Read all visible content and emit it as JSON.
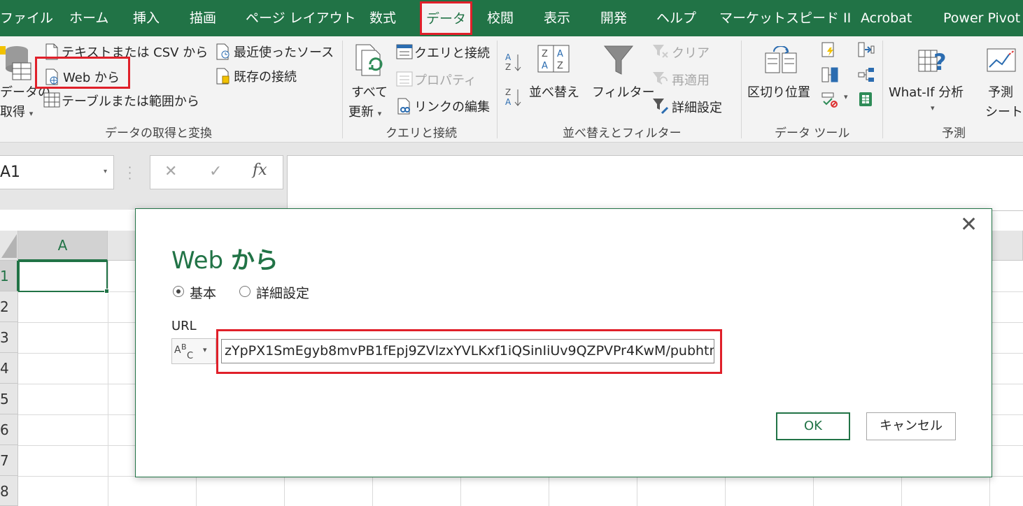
{
  "ribbon_tabs": [
    "ファイル",
    "ホーム",
    "挿入",
    "描画",
    "ページ レイアウト",
    "数式",
    "データ",
    "校閲",
    "表示",
    "開発",
    "ヘルプ",
    "マーケットスピード II",
    "Acrobat",
    "Power Pivot"
  ],
  "active_tab": "データ",
  "groups": {
    "get_transform": {
      "label": "データの取得と変換",
      "get_data": [
        "データの",
        "取得"
      ],
      "text_csv": "テキストまたは CSV から",
      "from_web": "Web から",
      "from_table": "テーブルまたは範囲から",
      "recent_sources": "最近使ったソース",
      "existing_connections": "既存の接続"
    },
    "queries": {
      "label": "クエリと接続",
      "refresh_all": [
        "すべて",
        "更新"
      ],
      "queries_connections": "クエリと接続",
      "properties": "プロパティ",
      "edit_links": "リンクの編集"
    },
    "sort_filter": {
      "label": "並べ替えとフィルター",
      "sort": "並べ替え",
      "filter": "フィルター",
      "clear": "クリア",
      "reapply": "再適用",
      "advanced": "詳細設定"
    },
    "data_tools": {
      "label": "データ ツール",
      "text_to_columns": "区切り位置"
    },
    "forecast": {
      "label": "予測",
      "what_if": "What-If 分析",
      "forecast_sheet": [
        "予測",
        "シート"
      ]
    }
  },
  "name_box": "A1",
  "formula_icons": [
    "cancel-icon",
    "enter-icon",
    "function-icon"
  ],
  "fx_label": "fx",
  "sheet": {
    "columns": [
      "A"
    ],
    "rows": [
      "1",
      "2",
      "3",
      "4",
      "5",
      "6",
      "7",
      "8"
    ]
  },
  "dialog": {
    "title_latin": "Web ",
    "title_kana": "から",
    "radio_basic": "基本",
    "radio_advanced": "詳細設定",
    "url_label": "URL",
    "abc_label": "ABC",
    "url_value": "zYpPX1SmEgyb8mvPB1fEpj9ZVlzxYVLKxf1iQSinIiUv9QZPVPr4KwM/pubhtml",
    "ok": "OK",
    "cancel": "キャンセル",
    "close_glyph": "✕"
  },
  "colors": {
    "excel_green": "#217346",
    "highlight_red": "#e0202a"
  }
}
